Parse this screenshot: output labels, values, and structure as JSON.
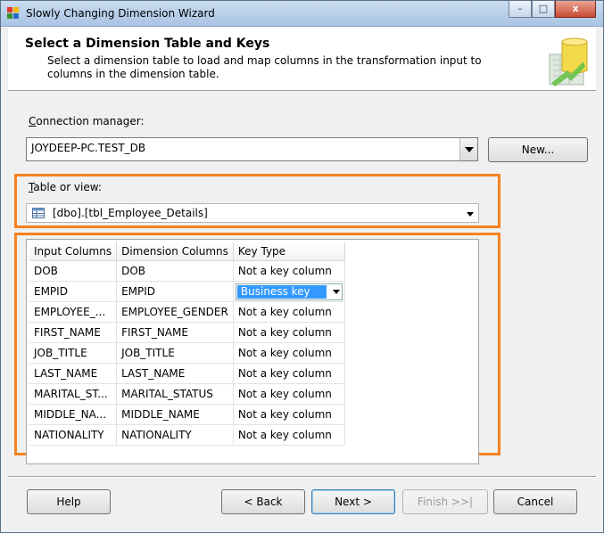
{
  "window": {
    "title": "Slowly Changing Dimension Wizard",
    "minimize": "–",
    "maximize": "□",
    "close": "x"
  },
  "header": {
    "title": "Select a Dimension Table and Keys",
    "description": "Select a dimension table to load and map columns in the transformation input to columns in the dimension table."
  },
  "connection": {
    "label_accel": "C",
    "label_rest": "onnection manager:",
    "value": "JOYDEEP-PC.TEST_DB",
    "new_button": "New..."
  },
  "table": {
    "label_accel": "T",
    "label_rest": "able or view:",
    "value": "[dbo].[tbl_Employee_Details]"
  },
  "grid": {
    "headers": [
      "Input Columns",
      "Dimension Columns",
      "Key Type"
    ],
    "rows": [
      {
        "input": "DOB",
        "dimension": "DOB",
        "key": "Not a key column"
      },
      {
        "input": "EMPID",
        "dimension": "EMPID",
        "key": "Business key"
      },
      {
        "input": "EMPLOYEE_...",
        "dimension": "EMPLOYEE_GENDER",
        "key": "Not a key column"
      },
      {
        "input": "FIRST_NAME",
        "dimension": "FIRST_NAME",
        "key": "Not a key column"
      },
      {
        "input": "JOB_TITLE",
        "dimension": "JOB_TITLE",
        "key": "Not a key column"
      },
      {
        "input": "LAST_NAME",
        "dimension": "LAST_NAME",
        "key": "Not a key column"
      },
      {
        "input": "MARITAL_ST...",
        "dimension": "MARITAL_STATUS",
        "key": "Not a key column"
      },
      {
        "input": "MIDDLE_NA...",
        "dimension": "MIDDLE_NAME",
        "key": "Not a key column"
      },
      {
        "input": "NATIONALITY",
        "dimension": "NATIONALITY",
        "key": "Not a key column"
      }
    ]
  },
  "buttons": {
    "help": "Help",
    "back": "< Back",
    "next": "Next >",
    "finish": "Finish >>|",
    "cancel": "Cancel"
  },
  "colors": {
    "highlight": "#f58220",
    "selection": "#3399ff"
  }
}
